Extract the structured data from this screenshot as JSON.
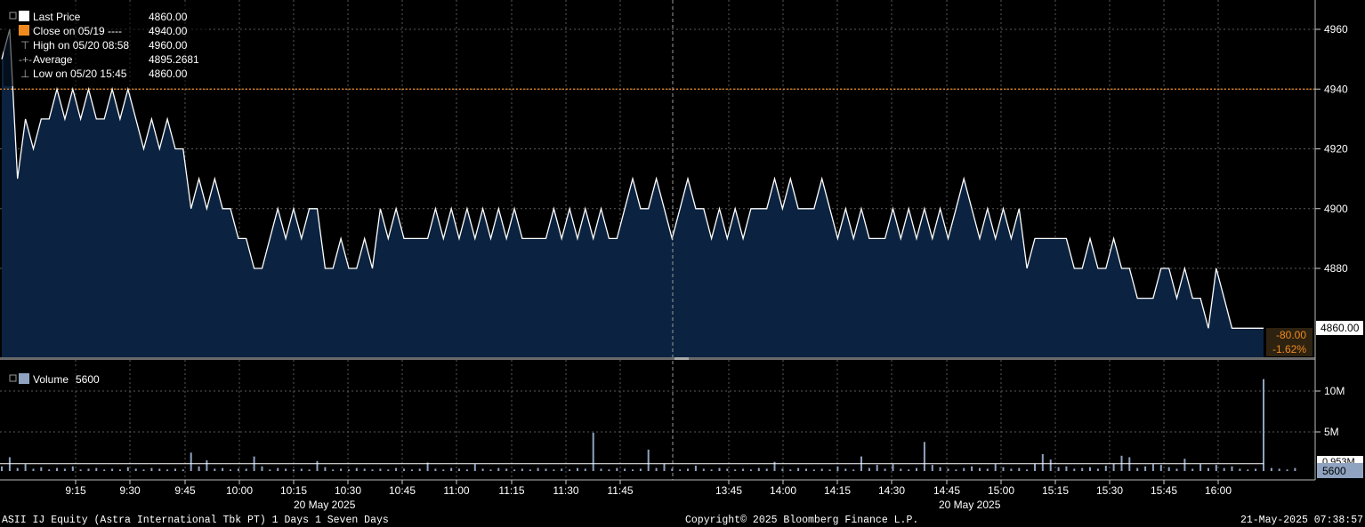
{
  "colors": {
    "background": "#000000",
    "area_fill": "#0b2340",
    "price_line": "#ffffff",
    "prev_close": "#f08a1e",
    "grid": "#5a5a5a",
    "volume_bar": "#8fa3c0",
    "change_box": "#2e2210"
  },
  "legend": {
    "last_price_label": "Last Price",
    "last_price_value": "4860.00",
    "close_label": "Close on 05/19 ----",
    "close_value": "4940.00",
    "high_label": "High on 05/20 08:58",
    "high_value": "4960.00",
    "average_label": "Average",
    "average_value": "4895.2681",
    "low_label": "Low on 05/20 15:45",
    "low_value": "4860.00"
  },
  "price_axis": {
    "ticks": [
      "4960",
      "4940",
      "4920",
      "4900",
      "4880"
    ],
    "last_label": "4860.00",
    "change_abs": "-80.00",
    "change_pct": "-1.62%"
  },
  "volume_panel": {
    "legend_label": "Volume",
    "legend_value": "5600",
    "axis_ticks": [
      "10M",
      "5M"
    ],
    "avg_label": "0.953M",
    "last_label": "5600"
  },
  "time_axis": {
    "ticks": [
      "9:15",
      "9:30",
      "9:45",
      "10:00",
      "10:15",
      "10:30",
      "10:45",
      "11:00",
      "11:15",
      "11:30",
      "11:45",
      "13:45",
      "14:00",
      "14:15",
      "14:30",
      "14:45",
      "15:00",
      "15:15",
      "15:30",
      "15:45",
      "16:00"
    ],
    "date_left": "20 May 2025",
    "date_right": "20 May 2025"
  },
  "footer": {
    "security": "ASII IJ Equity (Astra International Tbk PT) 1 Days 1 Seven Days",
    "copyright": "Copyright© 2025 Bloomberg Finance L.P.",
    "timestamp": "21-May-2025 07:38:57"
  },
  "chart_data": {
    "type": "line",
    "y_range": [
      4845,
      4965
    ],
    "prev_close": 4940,
    "price": [
      4950,
      4960,
      4910,
      4930,
      4920,
      4930,
      4930,
      4940,
      4930,
      4940,
      4930,
      4940,
      4930,
      4930,
      4940,
      4930,
      4940,
      4930,
      4920,
      4930,
      4920,
      4930,
      4920,
      4920,
      4900,
      4910,
      4900,
      4910,
      4900,
      4900,
      4890,
      4890,
      4880,
      4880,
      4890,
      4900,
      4890,
      4900,
      4890,
      4900,
      4900,
      4880,
      4880,
      4890,
      4880,
      4880,
      4890,
      4880,
      4900,
      4890,
      4900,
      4890,
      4890,
      4890,
      4890,
      4900,
      4890,
      4900,
      4890,
      4900,
      4890,
      4900,
      4890,
      4900,
      4890,
      4900,
      4890,
      4890,
      4890,
      4890,
      4900,
      4890,
      4900,
      4890,
      4900,
      4890,
      4900,
      4890,
      4890,
      4900,
      4910,
      4900,
      4900,
      4910,
      4900,
      4890,
      4900,
      4910,
      4900,
      4900,
      4890,
      4900,
      4890,
      4900,
      4890,
      4900,
      4900,
      4900,
      4910,
      4900,
      4910,
      4900,
      4900,
      4900,
      4910,
      4900,
      4890,
      4900,
      4890,
      4900,
      4890,
      4890,
      4890,
      4900,
      4890,
      4900,
      4890,
      4900,
      4890,
      4900,
      4890,
      4900,
      4910,
      4900,
      4890,
      4900,
      4890,
      4900,
      4890,
      4900,
      4880,
      4890,
      4890,
      4890,
      4890,
      4890,
      4880,
      4880,
      4890,
      4880,
      4880,
      4890,
      4880,
      4880,
      4870,
      4870,
      4870,
      4880,
      4880,
      4870,
      4880,
      4870,
      4870,
      4860,
      4880,
      4870,
      4860,
      4860,
      4860,
      4860,
      4860
    ],
    "volume_millions": [
      0.6,
      1.8,
      0.4,
      0.9,
      0.3,
      0.5,
      0.2,
      0.4,
      0.3,
      0.6,
      0.2,
      0.3,
      0.4,
      0.2,
      0.3,
      0.2,
      0.5,
      0.3,
      0.2,
      0.4,
      0.3,
      0.2,
      0.3,
      0.2,
      2.4,
      0.6,
      1.4,
      0.3,
      0.4,
      0.2,
      0.3,
      0.3,
      1.9,
      0.6,
      0.2,
      0.4,
      0.3,
      0.2,
      0.3,
      0.2,
      1.3,
      0.5,
      0.2,
      0.3,
      0.2,
      0.4,
      0.3,
      0.2,
      0.3,
      0.2,
      0.4,
      0.3,
      0.2,
      0.3,
      1.1,
      0.3,
      0.2,
      0.4,
      0.3,
      0.2,
      0.9,
      0.3,
      0.2,
      0.4,
      0.3,
      0.2,
      0.3,
      0.2,
      0.4,
      0.3,
      0.2,
      0.3,
      0.2,
      0.4,
      0.3,
      5.0,
      0.3,
      0.2,
      0.4,
      0.3,
      0.2,
      0.3,
      2.8,
      0.4,
      1.0,
      0.3,
      0.2,
      0.3,
      0.7,
      0.3,
      0.2,
      0.4,
      0.3,
      0.2,
      0.3,
      0.2,
      0.4,
      0.3,
      1.2,
      0.3,
      0.2,
      0.4,
      0.3,
      0.2,
      0.3,
      0.2,
      0.6,
      0.3,
      0.2,
      1.9,
      0.4,
      0.8,
      0.3,
      0.9,
      0.3,
      0.2,
      0.4,
      3.8,
      0.8,
      0.5,
      0.3,
      0.2,
      0.4,
      0.6,
      0.4,
      0.3,
      0.9,
      0.5,
      0.3,
      0.4,
      0.2,
      1.0,
      2.2,
      1.5,
      0.5,
      0.6,
      0.3,
      0.4,
      0.5,
      0.3,
      0.7,
      1.0,
      2.0,
      1.8,
      0.4,
      0.6,
      0.9,
      0.8,
      0.5,
      0.3,
      1.6,
      0.3,
      0.9,
      0.4,
      0.8,
      0.4,
      0.6,
      0.3,
      0.2,
      0.3,
      12.0,
      0.4,
      0.3,
      0.2,
      0.4
    ],
    "volume_avg_millions": 0.953,
    "volume_range": [
      0,
      13
    ]
  }
}
